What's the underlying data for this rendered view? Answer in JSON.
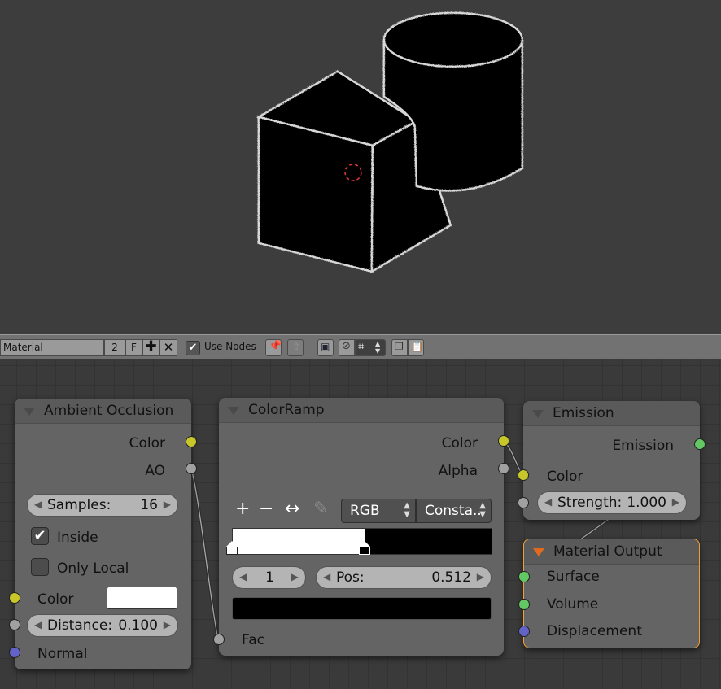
{
  "header": {
    "material_name": "Material",
    "users": "2",
    "fake_user": "F",
    "use_nodes_label": "Use Nodes",
    "use_nodes_checked": true
  },
  "nodes": {
    "ambient_occlusion": {
      "title": "Ambient Occlusion",
      "outputs": [
        "Color",
        "AO"
      ],
      "samples_label": "Samples:",
      "samples_value": "16",
      "inside_label": "Inside",
      "inside_checked": true,
      "only_local_label": "Only Local",
      "only_local_checked": false,
      "color_label": "Color",
      "color_value": "#ffffff",
      "distance_label": "Distance:",
      "distance_value": "0.100",
      "normal_label": "Normal"
    },
    "colorramp": {
      "title": "ColorRamp",
      "outputs": [
        "Color",
        "Alpha"
      ],
      "color_mode": "RGB",
      "interpolation": "Consta..",
      "stop_index": "1",
      "pos_label": "Pos:",
      "pos_value": "0.512",
      "fac_label": "Fac",
      "stops": [
        {
          "position": 0.0,
          "color": "#ffffff"
        },
        {
          "position": 0.512,
          "color": "#000000"
        }
      ],
      "active_color": "#000000"
    },
    "emission": {
      "title": "Emission",
      "output": "Emission",
      "color_label": "Color",
      "strength_label": "Strength:",
      "strength_value": "1.000"
    },
    "material_output": {
      "title": "Material Output",
      "inputs": [
        "Surface",
        "Volume",
        "Displacement"
      ]
    }
  },
  "colors": {
    "socket_color": "#c7c72a",
    "socket_float": "#a1a1a1",
    "socket_shader": "#63c763",
    "socket_vector": "#6363c7",
    "active_node_border": "#f0a030",
    "viewport_bg": "#3d3d3d"
  }
}
